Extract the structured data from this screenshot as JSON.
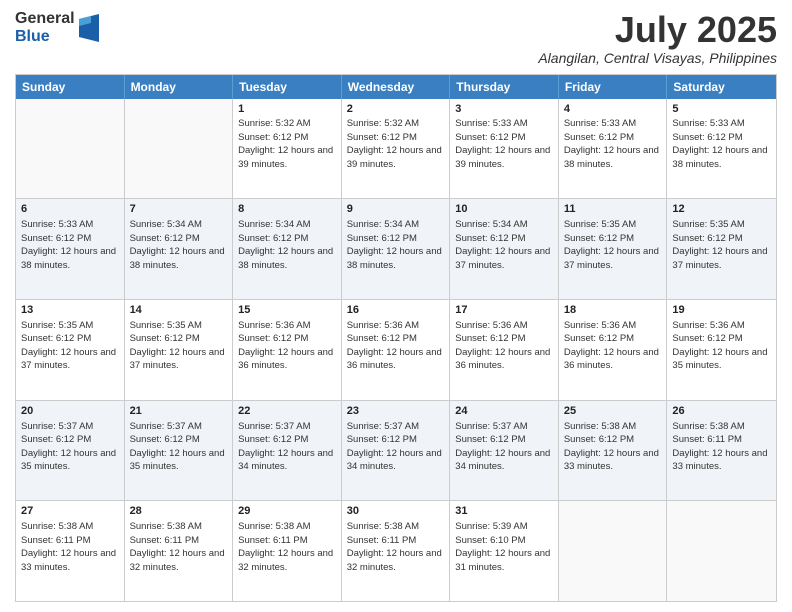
{
  "logo": {
    "general": "General",
    "blue": "Blue"
  },
  "header": {
    "month": "July 2025",
    "location": "Alangilan, Central Visayas, Philippines"
  },
  "weekdays": [
    "Sunday",
    "Monday",
    "Tuesday",
    "Wednesday",
    "Thursday",
    "Friday",
    "Saturday"
  ],
  "rows": [
    [
      {
        "day": "",
        "empty": true
      },
      {
        "day": "",
        "empty": true
      },
      {
        "day": "1",
        "sunrise": "Sunrise: 5:32 AM",
        "sunset": "Sunset: 6:12 PM",
        "daylight": "Daylight: 12 hours and 39 minutes."
      },
      {
        "day": "2",
        "sunrise": "Sunrise: 5:32 AM",
        "sunset": "Sunset: 6:12 PM",
        "daylight": "Daylight: 12 hours and 39 minutes."
      },
      {
        "day": "3",
        "sunrise": "Sunrise: 5:33 AM",
        "sunset": "Sunset: 6:12 PM",
        "daylight": "Daylight: 12 hours and 39 minutes."
      },
      {
        "day": "4",
        "sunrise": "Sunrise: 5:33 AM",
        "sunset": "Sunset: 6:12 PM",
        "daylight": "Daylight: 12 hours and 38 minutes."
      },
      {
        "day": "5",
        "sunrise": "Sunrise: 5:33 AM",
        "sunset": "Sunset: 6:12 PM",
        "daylight": "Daylight: 12 hours and 38 minutes."
      }
    ],
    [
      {
        "day": "6",
        "sunrise": "Sunrise: 5:33 AM",
        "sunset": "Sunset: 6:12 PM",
        "daylight": "Daylight: 12 hours and 38 minutes."
      },
      {
        "day": "7",
        "sunrise": "Sunrise: 5:34 AM",
        "sunset": "Sunset: 6:12 PM",
        "daylight": "Daylight: 12 hours and 38 minutes."
      },
      {
        "day": "8",
        "sunrise": "Sunrise: 5:34 AM",
        "sunset": "Sunset: 6:12 PM",
        "daylight": "Daylight: 12 hours and 38 minutes."
      },
      {
        "day": "9",
        "sunrise": "Sunrise: 5:34 AM",
        "sunset": "Sunset: 6:12 PM",
        "daylight": "Daylight: 12 hours and 38 minutes."
      },
      {
        "day": "10",
        "sunrise": "Sunrise: 5:34 AM",
        "sunset": "Sunset: 6:12 PM",
        "daylight": "Daylight: 12 hours and 37 minutes."
      },
      {
        "day": "11",
        "sunrise": "Sunrise: 5:35 AM",
        "sunset": "Sunset: 6:12 PM",
        "daylight": "Daylight: 12 hours and 37 minutes."
      },
      {
        "day": "12",
        "sunrise": "Sunrise: 5:35 AM",
        "sunset": "Sunset: 6:12 PM",
        "daylight": "Daylight: 12 hours and 37 minutes."
      }
    ],
    [
      {
        "day": "13",
        "sunrise": "Sunrise: 5:35 AM",
        "sunset": "Sunset: 6:12 PM",
        "daylight": "Daylight: 12 hours and 37 minutes."
      },
      {
        "day": "14",
        "sunrise": "Sunrise: 5:35 AM",
        "sunset": "Sunset: 6:12 PM",
        "daylight": "Daylight: 12 hours and 37 minutes."
      },
      {
        "day": "15",
        "sunrise": "Sunrise: 5:36 AM",
        "sunset": "Sunset: 6:12 PM",
        "daylight": "Daylight: 12 hours and 36 minutes."
      },
      {
        "day": "16",
        "sunrise": "Sunrise: 5:36 AM",
        "sunset": "Sunset: 6:12 PM",
        "daylight": "Daylight: 12 hours and 36 minutes."
      },
      {
        "day": "17",
        "sunrise": "Sunrise: 5:36 AM",
        "sunset": "Sunset: 6:12 PM",
        "daylight": "Daylight: 12 hours and 36 minutes."
      },
      {
        "day": "18",
        "sunrise": "Sunrise: 5:36 AM",
        "sunset": "Sunset: 6:12 PM",
        "daylight": "Daylight: 12 hours and 36 minutes."
      },
      {
        "day": "19",
        "sunrise": "Sunrise: 5:36 AM",
        "sunset": "Sunset: 6:12 PM",
        "daylight": "Daylight: 12 hours and 35 minutes."
      }
    ],
    [
      {
        "day": "20",
        "sunrise": "Sunrise: 5:37 AM",
        "sunset": "Sunset: 6:12 PM",
        "daylight": "Daylight: 12 hours and 35 minutes."
      },
      {
        "day": "21",
        "sunrise": "Sunrise: 5:37 AM",
        "sunset": "Sunset: 6:12 PM",
        "daylight": "Daylight: 12 hours and 35 minutes."
      },
      {
        "day": "22",
        "sunrise": "Sunrise: 5:37 AM",
        "sunset": "Sunset: 6:12 PM",
        "daylight": "Daylight: 12 hours and 34 minutes."
      },
      {
        "day": "23",
        "sunrise": "Sunrise: 5:37 AM",
        "sunset": "Sunset: 6:12 PM",
        "daylight": "Daylight: 12 hours and 34 minutes."
      },
      {
        "day": "24",
        "sunrise": "Sunrise: 5:37 AM",
        "sunset": "Sunset: 6:12 PM",
        "daylight": "Daylight: 12 hours and 34 minutes."
      },
      {
        "day": "25",
        "sunrise": "Sunrise: 5:38 AM",
        "sunset": "Sunset: 6:12 PM",
        "daylight": "Daylight: 12 hours and 33 minutes."
      },
      {
        "day": "26",
        "sunrise": "Sunrise: 5:38 AM",
        "sunset": "Sunset: 6:11 PM",
        "daylight": "Daylight: 12 hours and 33 minutes."
      }
    ],
    [
      {
        "day": "27",
        "sunrise": "Sunrise: 5:38 AM",
        "sunset": "Sunset: 6:11 PM",
        "daylight": "Daylight: 12 hours and 33 minutes."
      },
      {
        "day": "28",
        "sunrise": "Sunrise: 5:38 AM",
        "sunset": "Sunset: 6:11 PM",
        "daylight": "Daylight: 12 hours and 32 minutes."
      },
      {
        "day": "29",
        "sunrise": "Sunrise: 5:38 AM",
        "sunset": "Sunset: 6:11 PM",
        "daylight": "Daylight: 12 hours and 32 minutes."
      },
      {
        "day": "30",
        "sunrise": "Sunrise: 5:38 AM",
        "sunset": "Sunset: 6:11 PM",
        "daylight": "Daylight: 12 hours and 32 minutes."
      },
      {
        "day": "31",
        "sunrise": "Sunrise: 5:39 AM",
        "sunset": "Sunset: 6:10 PM",
        "daylight": "Daylight: 12 hours and 31 minutes."
      },
      {
        "day": "",
        "empty": true
      },
      {
        "day": "",
        "empty": true
      }
    ]
  ]
}
